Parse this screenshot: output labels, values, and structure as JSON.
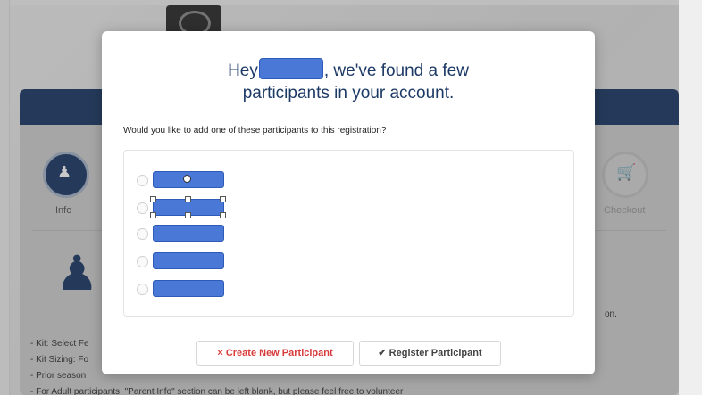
{
  "dialog": {
    "title_part1": "Hey",
    "title_part2": ", we've found a few",
    "title_line2": "participants in your account.",
    "question": "Would you like to add one of these participants to this registration?",
    "participants": [
      {
        "name": ""
      },
      {
        "name": ""
      },
      {
        "name": ""
      },
      {
        "name": ""
      },
      {
        "name": ""
      }
    ],
    "buttons": {
      "create": {
        "icon": "×",
        "label": "Create New Participant"
      },
      "register": {
        "icon": "✔",
        "label": "Register Participant"
      }
    }
  },
  "background": {
    "steps": [
      "Info",
      "Checkout"
    ],
    "text_lines": [
      "- Kit: Select Fe",
      "- Kit Sizing: Fo",
      "- Prior season",
      "- For Adult participants, \"Parent Info\" section can be left blank, but please feel free to volunteer"
    ],
    "trailing_text": "on."
  },
  "colors": {
    "brand_navy": "#1d3a66",
    "redaction_blue": "#4a78d6",
    "create_red": "#d83b3b"
  }
}
